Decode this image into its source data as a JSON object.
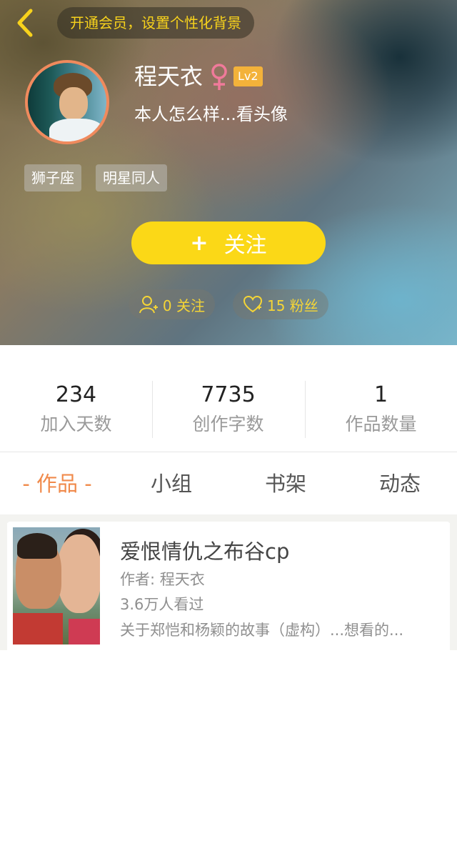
{
  "header": {
    "vip_banner": "开通会员，设置个性化背景",
    "nickname": "程天衣",
    "gender_icon": "female-symbol-icon",
    "level": "Lv2",
    "bio": "本人怎么样...看头像",
    "tags": [
      "狮子座",
      "明星同人"
    ],
    "follow_button_label": "关注",
    "following_count_label": "0 关注",
    "fans_count_label": "15 粉丝",
    "colors": {
      "accent_yellow": "#fbd817",
      "banner_text": "#f7d21c",
      "avatar_border": "#f08a5d",
      "gender_pink": "#f07a9a",
      "level_badge": "#f3b23a"
    }
  },
  "stats": [
    {
      "value": "234",
      "label": "加入天数"
    },
    {
      "value": "7735",
      "label": "创作字数"
    },
    {
      "value": "1",
      "label": "作品数量"
    }
  ],
  "tabs": [
    {
      "label": "- 作品 -",
      "active": true
    },
    {
      "label": "小组",
      "active": false
    },
    {
      "label": "书架",
      "active": false
    },
    {
      "label": "动态",
      "active": false
    }
  ],
  "works": [
    {
      "title": "爱恨情仇之布谷cp",
      "author": "作者: 程天衣",
      "views": "3.6万人看过",
      "description": "关于郑恺和杨颖的故事（虚构）...想看的..."
    }
  ]
}
